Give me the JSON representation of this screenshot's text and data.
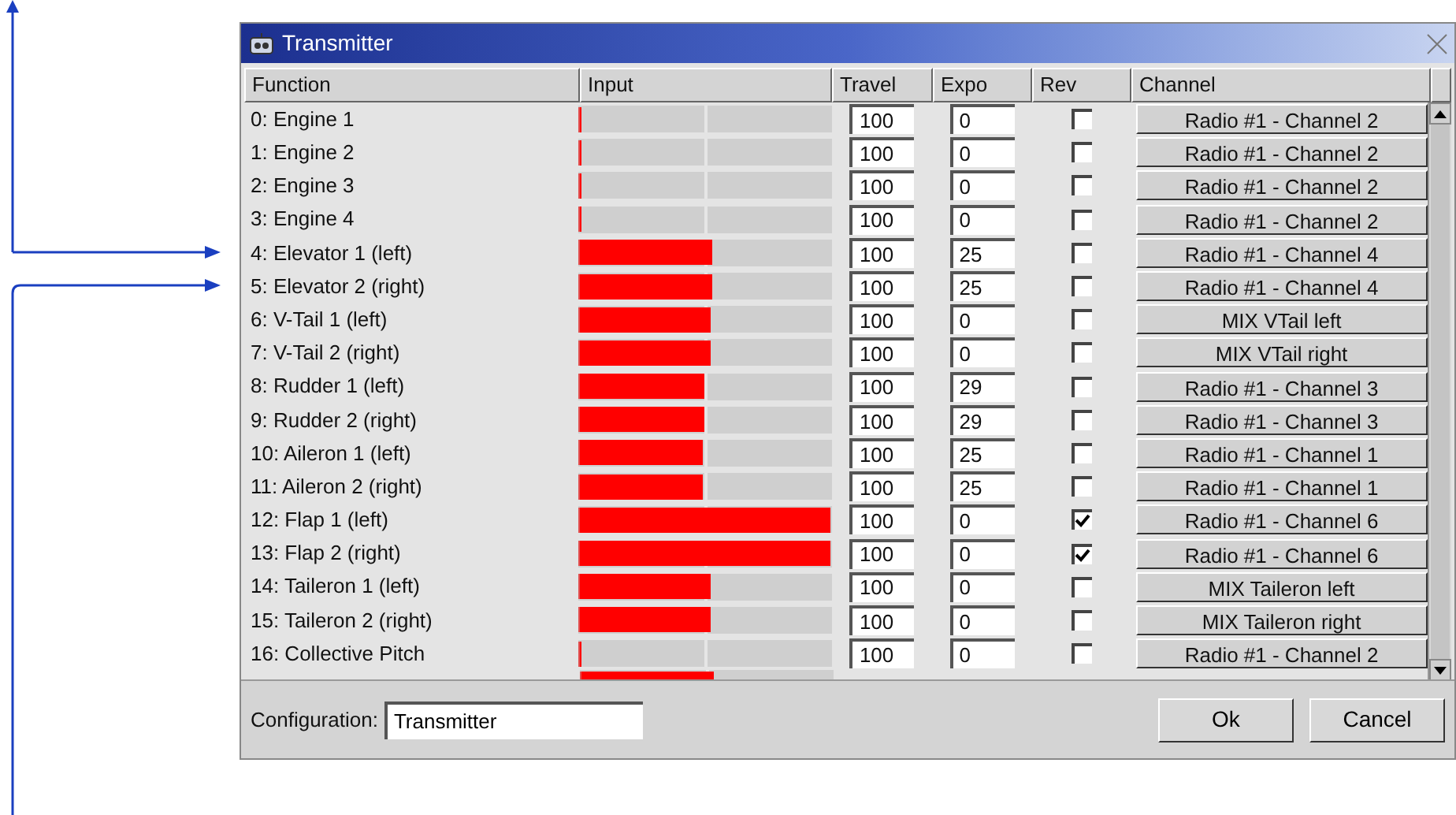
{
  "window": {
    "title": "Transmitter"
  },
  "table": {
    "columns": [
      "Function",
      "Input",
      "Travel",
      "Expo",
      "Rev",
      "Channel"
    ],
    "rows": [
      {
        "function": "0: Engine 1",
        "level": 0.01,
        "travel": "100",
        "expo": "0",
        "rev": false,
        "channel": "Radio #1 - Channel 2"
      },
      {
        "function": "1: Engine 2",
        "level": 0.01,
        "travel": "100",
        "expo": "0",
        "rev": false,
        "channel": "Radio #1 - Channel 2"
      },
      {
        "function": "2: Engine 3",
        "level": 0.01,
        "travel": "100",
        "expo": "0",
        "rev": false,
        "channel": "Radio #1 - Channel 2"
      },
      {
        "function": "3: Engine 4",
        "level": 0.01,
        "travel": "100",
        "expo": "0",
        "rev": false,
        "channel": "Radio #1 - Channel 2"
      },
      {
        "function": "4: Elevator 1 (left)",
        "level": 0.53,
        "travel": "100",
        "expo": "25",
        "rev": false,
        "channel": "Radio #1 - Channel 4"
      },
      {
        "function": "5: Elevator 2 (right)",
        "level": 0.53,
        "travel": "100",
        "expo": "25",
        "rev": false,
        "channel": "Radio #1 - Channel 4"
      },
      {
        "function": "6: V-Tail 1 (left)",
        "level": 0.52,
        "travel": "100",
        "expo": "0",
        "rev": false,
        "channel": "MIX VTail left"
      },
      {
        "function": "7: V-Tail 2 (right)",
        "level": 0.52,
        "travel": "100",
        "expo": "0",
        "rev": false,
        "channel": "MIX VTail right"
      },
      {
        "function": "8: Rudder 1 (left)",
        "level": 0.5,
        "travel": "100",
        "expo": "29",
        "rev": false,
        "channel": "Radio #1 - Channel 3"
      },
      {
        "function": "9: Rudder 2 (right)",
        "level": 0.5,
        "travel": "100",
        "expo": "29",
        "rev": false,
        "channel": "Radio #1 - Channel 3"
      },
      {
        "function": "10: Aileron 1 (left)",
        "level": 0.49,
        "travel": "100",
        "expo": "25",
        "rev": false,
        "channel": "Radio #1 - Channel 1"
      },
      {
        "function": "11: Aileron 2 (right)",
        "level": 0.49,
        "travel": "100",
        "expo": "25",
        "rev": false,
        "channel": "Radio #1 - Channel 1"
      },
      {
        "function": "12: Flap 1 (left)",
        "level": 1.0,
        "travel": "100",
        "expo": "0",
        "rev": true,
        "channel": "Radio #1 - Channel 6"
      },
      {
        "function": "13: Flap 2 (right)",
        "level": 1.0,
        "travel": "100",
        "expo": "0",
        "rev": true,
        "channel": "Radio #1 - Channel 6"
      },
      {
        "function": "14: Taileron 1 (left)",
        "level": 0.52,
        "travel": "100",
        "expo": "0",
        "rev": false,
        "channel": "MIX Taileron left"
      },
      {
        "function": "15: Taileron 2 (right)",
        "level": 0.52,
        "travel": "100",
        "expo": "0",
        "rev": false,
        "channel": "MIX Taileron right"
      },
      {
        "function": "16: Collective Pitch",
        "level": 0.01,
        "travel": "100",
        "expo": "0",
        "rev": false,
        "channel": "Radio #1 - Channel 2"
      }
    ],
    "partial_row": {
      "level": 0.53
    }
  },
  "configuration": {
    "label": "Configuration:",
    "value": "Transmitter"
  },
  "buttons": [
    "Ok",
    "Cancel"
  ]
}
